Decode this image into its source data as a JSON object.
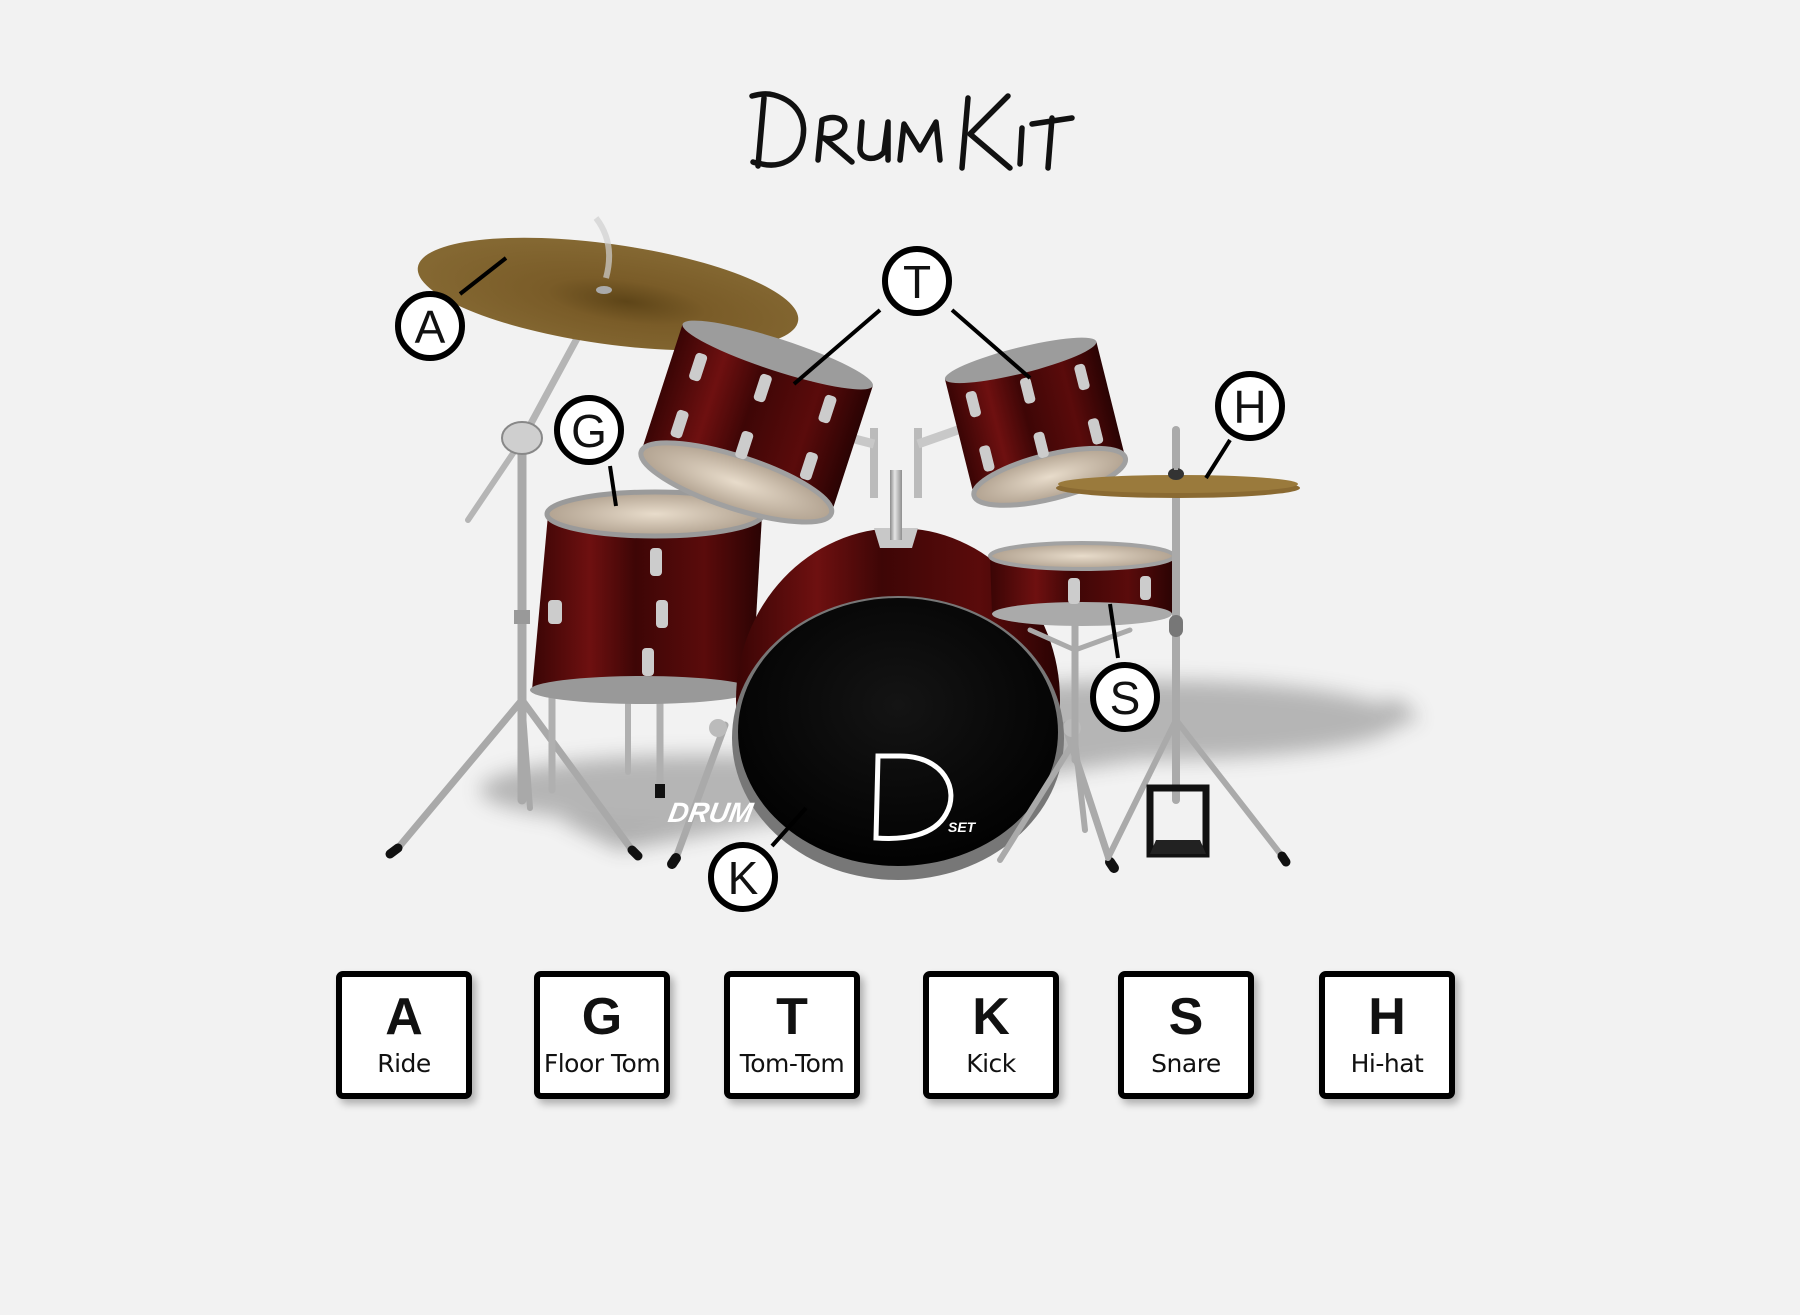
{
  "title": "Drum Kit",
  "logo": {
    "text_main": "DRUM",
    "text_sub": "SET"
  },
  "callouts": [
    {
      "letter": "A",
      "target": "ride-cymbal"
    },
    {
      "letter": "G",
      "target": "floor-tom"
    },
    {
      "letter": "T",
      "target": "tom-toms"
    },
    {
      "letter": "H",
      "target": "hi-hat"
    },
    {
      "letter": "S",
      "target": "snare-drum"
    },
    {
      "letter": "K",
      "target": "kick-drum"
    }
  ],
  "keys": [
    {
      "letter": "A",
      "name": "Ride"
    },
    {
      "letter": "G",
      "name": "Floor Tom"
    },
    {
      "letter": "T",
      "name": "Tom-Tom"
    },
    {
      "letter": "K",
      "name": "Kick"
    },
    {
      "letter": "S",
      "name": "Snare"
    },
    {
      "letter": "H",
      "name": "Hi-hat"
    }
  ],
  "colors": {
    "background": "#f2f2f2",
    "shell": "#5a0a0a",
    "cymbal": "#7a5c28",
    "chrome": "#b8b8b8",
    "bass_head": "#0a0a0a",
    "key_border": "#000000"
  }
}
